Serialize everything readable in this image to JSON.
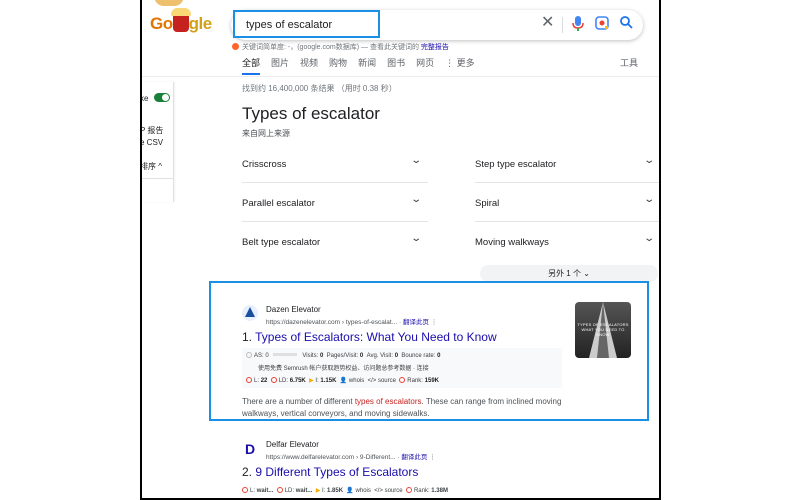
{
  "search": {
    "query": "types of escalator"
  },
  "logo": {
    "text_a": "Go",
    "text_b": "gle"
  },
  "semrush_line": {
    "text": "关键词简单度: -，(google.com数据库) — 查看此关键词的",
    "link": "完整报告"
  },
  "tabs": [
    {
      "label": "全部",
      "active": true
    },
    {
      "label": "图片"
    },
    {
      "label": "视频"
    },
    {
      "label": "购物"
    },
    {
      "label": "新闻"
    },
    {
      "label": "图书"
    },
    {
      "label": "网页"
    },
    {
      "label": "⋮ 更多"
    }
  ],
  "tools_label": "工具",
  "left_panel": {
    "toggle_label": "ke",
    "report_line1": "P 报告",
    "report_line2": "e CSV",
    "sort_label": "排序 ^"
  },
  "result_stats": "找到约 16,400,000 条结果 （用时 0.38 秒）",
  "featured": {
    "title": "Types of escalator",
    "subtitle": "来自网上来源",
    "items_left": [
      "Crisscross",
      "Parallel escalator",
      "Belt type escalator"
    ],
    "items_right": [
      "Step type escalator",
      "Spiral",
      "Moving walkways"
    ],
    "more_label": "另外 1 个 ⌄"
  },
  "result1": {
    "site_name": "Dazen Elevator",
    "url": "https://dazenelevator.com › types-of-escalat...",
    "translate": "翻译此页",
    "title_num": "1.",
    "title": "Types of Escalators: What You Need to Know",
    "sr_row1": {
      "as": "AS: 0",
      "visits": "0",
      "pages": "0",
      "avg": "0",
      "bounce": "0"
    },
    "sr_row2": "使用免费 Semrush 帐户获取趋势权益、访问题总参考数据 · 连接",
    "sr_row3": {
      "l": "22",
      "ld": "6.75K",
      "i": "1.15K",
      "whois": "whois",
      "source": "source",
      "rank": "159K"
    },
    "snippet_pre": "There are a number of different ",
    "snippet_hl": "types of escalators",
    "snippet_post": ". These can range from inclined moving walkways, vertical conveyors, and moving sidewalks.",
    "thumb_text": "TYPES OF ESCALATORS WHAT YOU NEED TO KNOW"
  },
  "result2": {
    "site_name": "Delfar Elevator",
    "url": "https://www.delfarelevator.com › 9-Different...",
    "translate": "翻译此页",
    "title_num": "2.",
    "title": "9 Different Types of Escalators",
    "meta": {
      "l": "wait...",
      "ld": "wait...",
      "i": "1.85K",
      "whois": "whois",
      "source": "source",
      "rank": "1.38M"
    }
  },
  "sr_labels": {
    "visits": "Visits:",
    "pages": "Pages/Visit:",
    "avg": "Avg. Visit:",
    "bounce": "Bounce rate:",
    "l": "L:",
    "ld": "LD:",
    "i": "I:",
    "rank": "Rank:"
  },
  "colors": {
    "accent": "#1a73e8",
    "link": "#1a0dab",
    "highlight_box": "#1a8fe3"
  }
}
